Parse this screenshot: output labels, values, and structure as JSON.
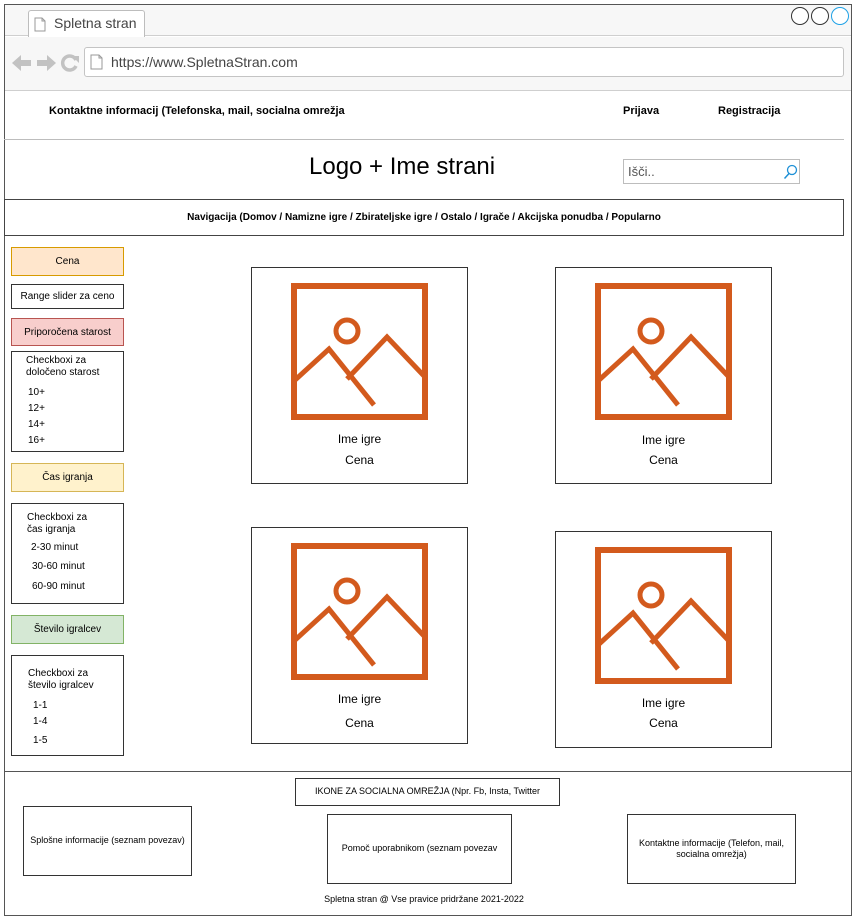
{
  "browser": {
    "tab_title": "Spletna stran",
    "url": "https://www.SpletnaStran.com"
  },
  "topbar": {
    "contacts": "Kontaktne informacij (Telefonska, mail, socialna omrežja",
    "login": "Prijava",
    "register": "Registracija"
  },
  "header": {
    "logo": "Logo + Ime strani",
    "search_placeholder": "Išči.."
  },
  "nav": {
    "text": "Navigacija (Domov / Namizne igre / Zbirateljske igre / Ostalo / Igrače / Akcijska ponudba / Popularno"
  },
  "sidebar": {
    "price_header": "Cena",
    "price_slider": "Range slider za ceno",
    "age_header": "Priporočena starost",
    "age_checkboxes_title": "Checkboxi za določeno starost",
    "age_options": [
      "10+",
      "12+",
      "14+",
      "16+"
    ],
    "time_header": "Čas igranja",
    "time_checkboxes_title": "Checkboxi za čas igranja",
    "time_options": [
      "2-30 minut",
      "30-60 minut",
      "60-90 minut"
    ],
    "players_header": "Število igralcev",
    "players_checkboxes_title": "Checkboxi za število igralcev",
    "players_options": [
      "1-1",
      "1-4",
      "1-5"
    ]
  },
  "products": [
    {
      "name": "Ime igre",
      "price": "Cena"
    },
    {
      "name": "Ime igre",
      "price": "Cena"
    },
    {
      "name": "Ime igre",
      "price": "Cena"
    },
    {
      "name": "Ime igre",
      "price": "Cena"
    }
  ],
  "footer": {
    "social": "IKONE ZA SOCIALNA OMREŽJA (Npr. Fb, Insta, Twitter",
    "general": "Splošne informacije (seznam povezav)",
    "help": "Pomoč uporabnikom (seznam povezav",
    "contact": "Kontaktne informacije (Telefon, mail, socialna omrežja)",
    "copyright": "Spletna stran @ Vse pravice pridržane 2021-2022"
  },
  "colors": {
    "image_icon": "#d35a1d",
    "price_header_bg": "#ffe6cc",
    "price_header_border": "#d79b00",
    "age_header_bg": "#f8cecc",
    "age_header_border": "#b85450",
    "time_header_bg": "#fff2cc",
    "time_header_border": "#d6b656",
    "players_header_bg": "#d5e8d4",
    "players_header_border": "#82b366"
  }
}
